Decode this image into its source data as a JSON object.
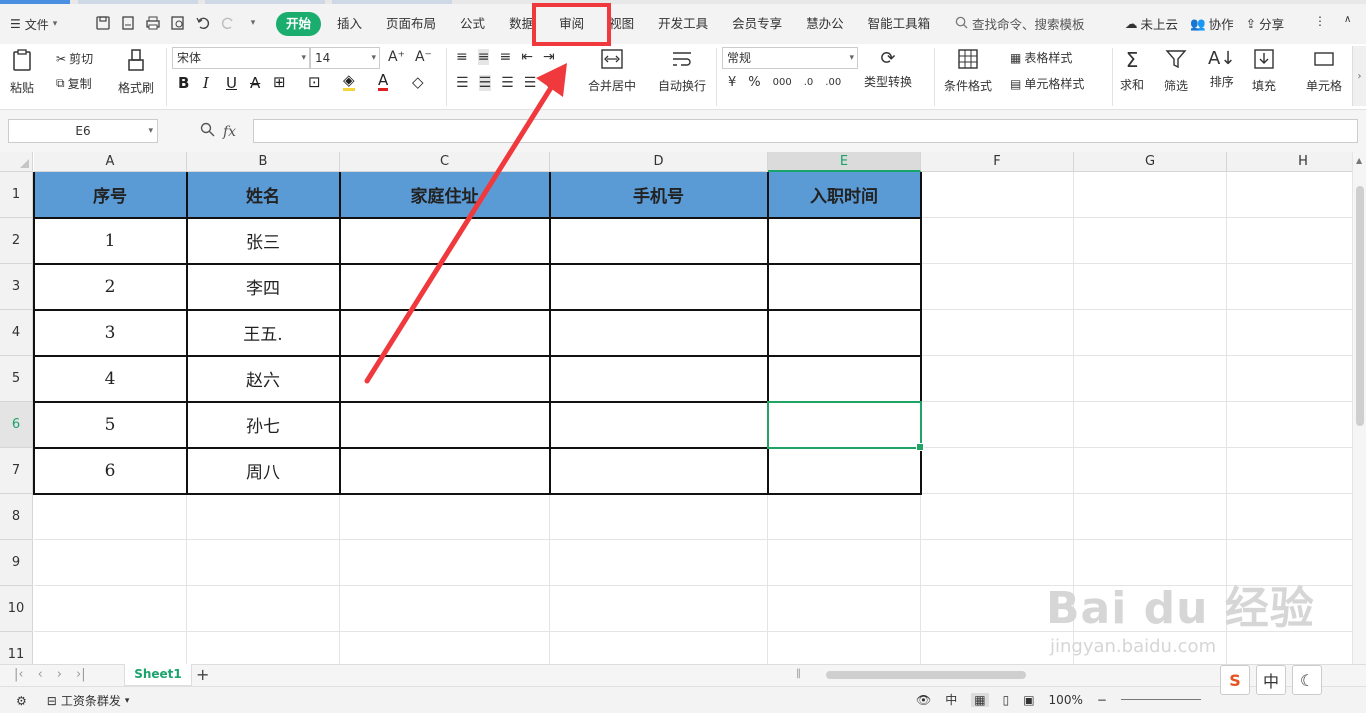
{
  "menu": {
    "file_label": "文件",
    "tabs": [
      "开始",
      "插入",
      "页面布局",
      "公式",
      "数据",
      "审阅",
      "视图",
      "开发工具",
      "会员专享",
      "慧办公",
      "智能工具箱"
    ],
    "search_label": "查找命令、搜索模板",
    "cloud_label": "未上云",
    "collab_label": "协作",
    "share_label": "分享"
  },
  "ribbon": {
    "paste": "粘贴",
    "cut": "剪切",
    "copy": "复制",
    "format_painter": "格式刷",
    "font_name": "宋体",
    "font_size": "14",
    "merge_center": "合并居中",
    "wrap_text": "自动换行",
    "number_format": "常规",
    "type_convert": "类型转换",
    "cond_format": "条件格式",
    "table_style": "表格样式",
    "cell_style": "单元格样式",
    "sum": "求和",
    "filter": "筛选",
    "sort": "排序",
    "fill": "填充",
    "cell": "单元格",
    "bold": "B",
    "italic": "I",
    "underline": "U"
  },
  "formula": {
    "cell_ref": "E6",
    "fx": "fx",
    "value": ""
  },
  "grid": {
    "columns": [
      "A",
      "B",
      "C",
      "D",
      "E",
      "F",
      "G",
      "H"
    ],
    "rows": [
      "1",
      "2",
      "3",
      "4",
      "5",
      "6",
      "7",
      "8",
      "9",
      "10",
      "11"
    ],
    "selected_column": "E",
    "selected_row": "6",
    "headers": [
      "序号",
      "姓名",
      "家庭住址",
      "手机号",
      "入职时间"
    ],
    "data": [
      [
        "1",
        "张三",
        "",
        "",
        ""
      ],
      [
        "2",
        "李四",
        "",
        "",
        ""
      ],
      [
        "3",
        "王五.",
        "",
        "",
        ""
      ],
      [
        "4",
        "赵六",
        "",
        "",
        ""
      ],
      [
        "5",
        "孙七",
        "",
        "",
        ""
      ],
      [
        "6",
        "周八",
        "",
        "",
        ""
      ]
    ],
    "header_color": "#5b9bd5",
    "selection_color": "#21a366"
  },
  "sheets": {
    "active": "Sheet1"
  },
  "status": {
    "macro_label": "工资条群发",
    "ime_label": "中",
    "zoom": "100%"
  },
  "watermark": {
    "text": "Bai du 经验",
    "url": "jingyan.baidu.com"
  },
  "ime_tray": {
    "logo": "S",
    "lang": "中",
    "moon": "☾"
  },
  "annotation": {
    "color": "#f0393c"
  }
}
